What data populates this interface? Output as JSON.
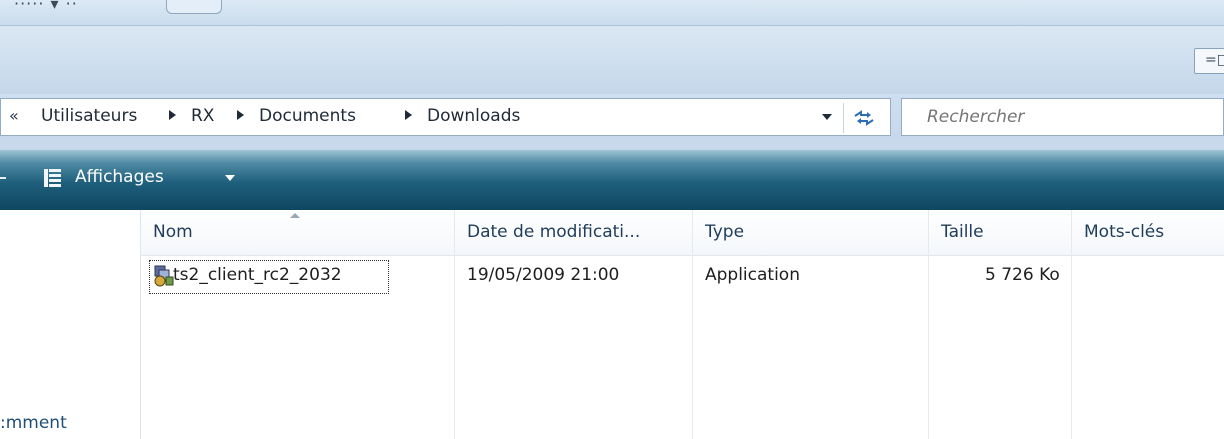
{
  "window": {
    "title_fragment": "·····  ▾  ··"
  },
  "address_bar": {
    "back_chevron": "«",
    "breadcrumbs": [
      "Utilisateurs",
      "RX",
      "Documents",
      "Downloads"
    ]
  },
  "search": {
    "placeholder": "Rechercher"
  },
  "toolbar": {
    "views_label": "Affichages"
  },
  "nav_pane": {
    "visible_item_fragment": ":mment"
  },
  "file_list": {
    "columns": [
      "Nom",
      "Date de modificati...",
      "Type",
      "Taille",
      "Mots-clés"
    ],
    "sort_column": "Nom",
    "rows": [
      {
        "name": "ts2_client_rc2_2032",
        "date_modified": "19/05/2009 21:00",
        "type": "Application",
        "size": "5 726 Ko",
        "tags": ""
      }
    ]
  },
  "icons": {
    "views": "views-grid-icon",
    "refresh": "refresh-icon",
    "application": "application-file-icon",
    "dropdown": "chevron-down-icon"
  },
  "colors": {
    "toolbar_dark": "#0e4761",
    "band_light": "#c4d7ea",
    "header_text": "#1f3c5a",
    "link_blue": "#1f4e79"
  }
}
